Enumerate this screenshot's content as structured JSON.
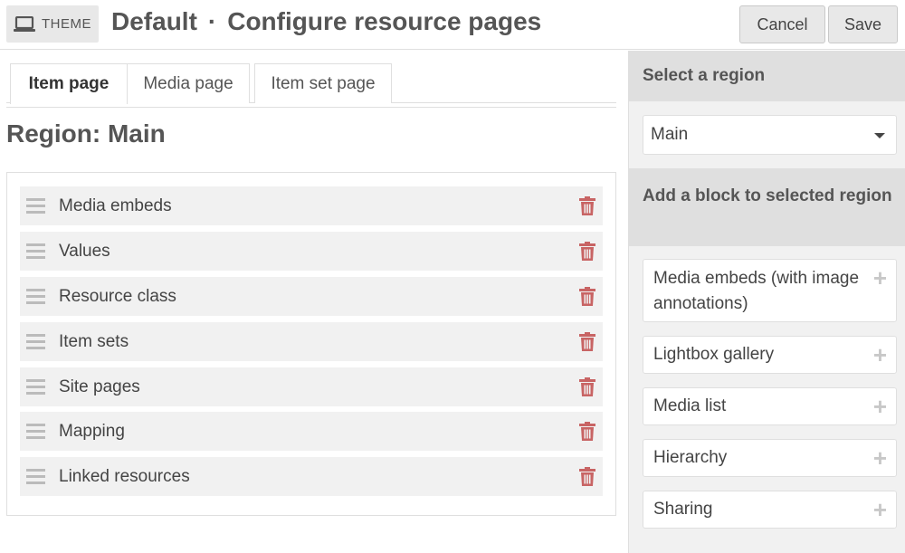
{
  "header": {
    "badge_label": "THEME",
    "badge_icon": "laptop-icon",
    "title_main": "Default",
    "title_separator": "·",
    "title_sub": "Configure resource pages",
    "cancel_label": "Cancel",
    "save_label": "Save"
  },
  "tabs": [
    {
      "label": "Item page",
      "active": true
    },
    {
      "label": "Media page",
      "active": false
    },
    {
      "label": "Item set page",
      "active": false
    }
  ],
  "region_title": "Region: Main",
  "blocks": [
    {
      "label": "Media embeds"
    },
    {
      "label": "Values"
    },
    {
      "label": "Resource class"
    },
    {
      "label": "Item sets"
    },
    {
      "label": "Site pages"
    },
    {
      "label": "Mapping"
    },
    {
      "label": "Linked resources"
    }
  ],
  "sidebar": {
    "select_heading": "Select a region",
    "select_value": "Main",
    "add_heading": "Add a block to selected region",
    "add_items": [
      {
        "label": "Media embeds (with image annotations)"
      },
      {
        "label": "Lightbox gallery"
      },
      {
        "label": "Media list"
      },
      {
        "label": "Hierarchy"
      },
      {
        "label": "Sharing"
      }
    ]
  },
  "colors": {
    "trash": "#c86464",
    "heading_bg": "#dfdfdf",
    "sidebar_bg": "#f1f1f1"
  }
}
